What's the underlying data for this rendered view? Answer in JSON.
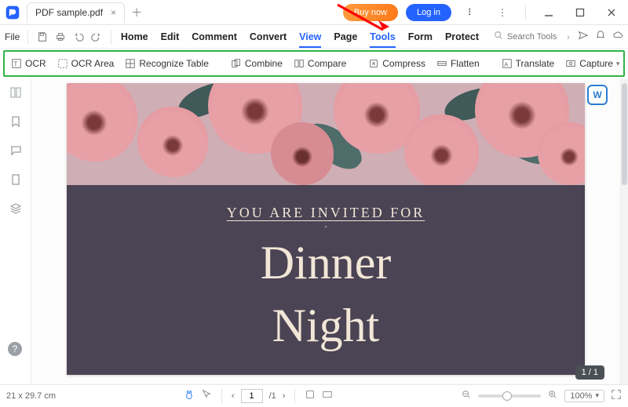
{
  "titlebar": {
    "document_name": "PDF sample.pdf",
    "buy_now": "Buy now",
    "log_in": "Log in"
  },
  "menubar": {
    "file_label": "File",
    "tabs": {
      "home": "Home",
      "edit": "Edit",
      "comment": "Comment",
      "convert": "Convert",
      "view": "View",
      "page": "Page",
      "tools": "Tools",
      "form": "Form",
      "protect": "Protect"
    },
    "search_placeholder": "Search Tools"
  },
  "ribbon": {
    "ocr": "OCR",
    "ocr_area": "OCR Area",
    "recognize_table": "Recognize Table",
    "combine": "Combine",
    "compare": "Compare",
    "compress": "Compress",
    "flatten": "Flatten",
    "translate": "Translate",
    "capture": "Capture"
  },
  "doc": {
    "line1": "YOU ARE INVITED FOR",
    "line2": "Dinner",
    "line3": "Night",
    "word_badge": "W"
  },
  "page_indicator": "1 / 1",
  "statusbar": {
    "dimensions": "21 x 29.7 cm",
    "page_current": "1",
    "page_total": "/1",
    "zoom": "100%"
  }
}
